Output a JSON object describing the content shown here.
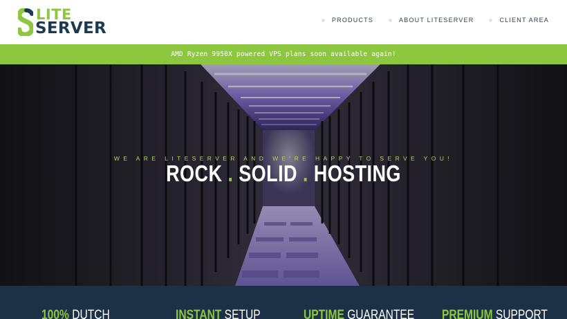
{
  "brand": {
    "logo_top": "LITE",
    "logo_bottom": "SERVER",
    "green": "#8dc63f",
    "navy": "#1d3a52"
  },
  "nav": {
    "items": [
      {
        "label": "PRODUCTS"
      },
      {
        "label": "ABOUT LITESERVER"
      },
      {
        "label": "CLIENT AREA"
      }
    ]
  },
  "announcement": {
    "text": "AMD Ryzen 9950X powered VPS plans soon available again!"
  },
  "hero": {
    "tagline": "WE ARE LITESERVER AND WE'RE HAPPY TO SERVE YOU!",
    "title_parts": [
      "ROCK",
      "SOLID",
      "HOSTING"
    ],
    "separator": "."
  },
  "features": [
    {
      "highlight": "100%",
      "rest": "DUTCH"
    },
    {
      "highlight": "INSTANT",
      "rest": "SETUP"
    },
    {
      "highlight": "UPTIME",
      "rest": "GUARANTEE"
    },
    {
      "highlight": "PREMIUM",
      "rest": "SUPPORT"
    }
  ]
}
